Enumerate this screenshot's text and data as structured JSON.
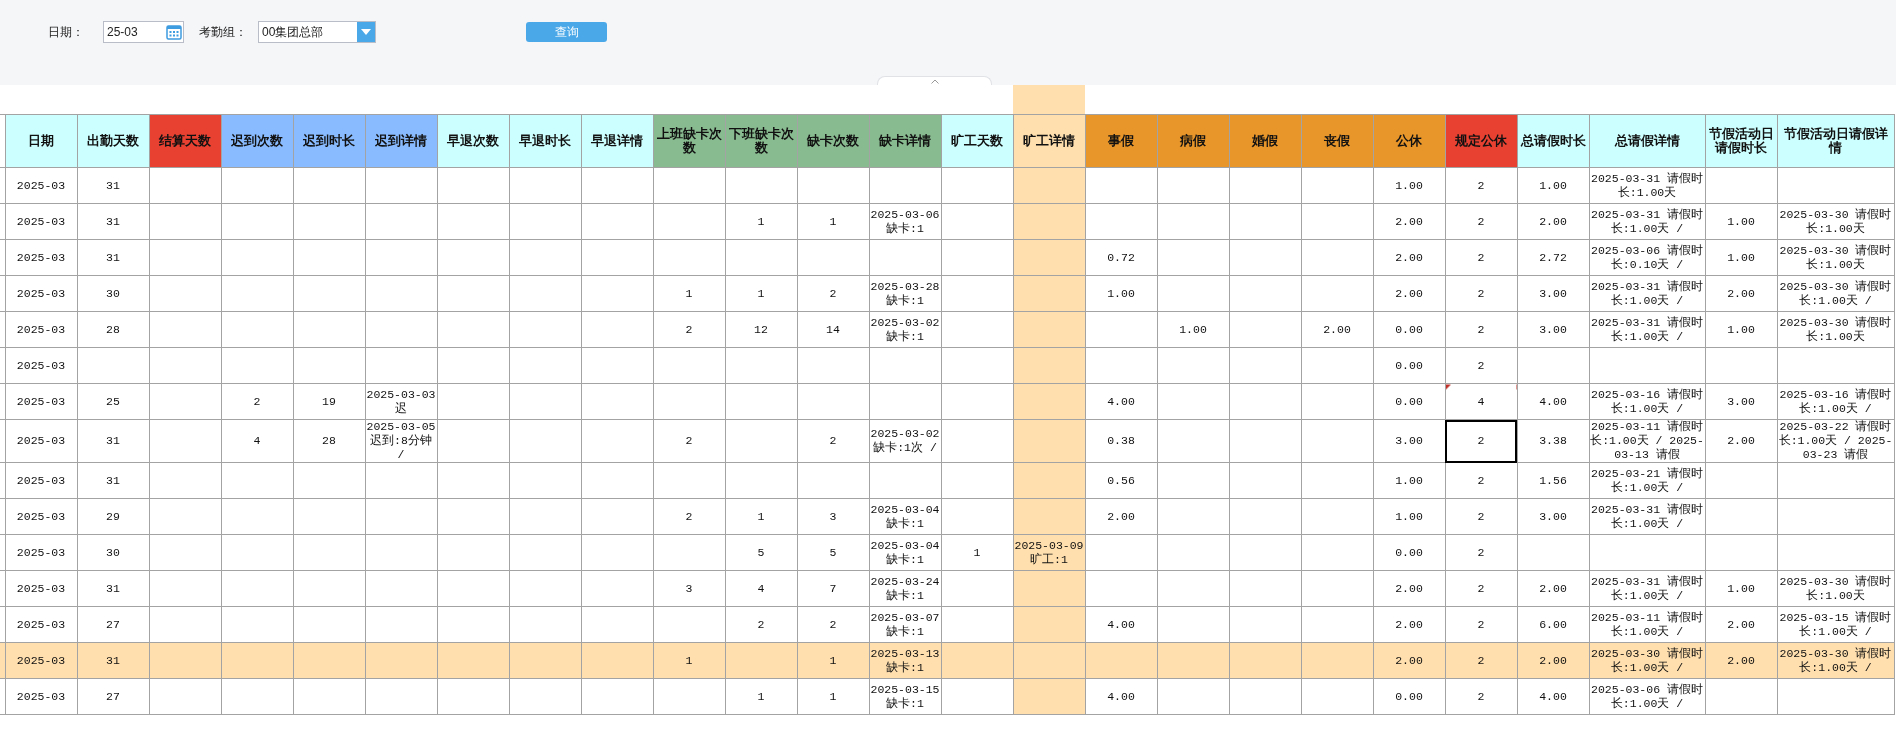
{
  "toolbar": {
    "date_label": "日期：",
    "date_field": {
      "value": "25-03"
    },
    "group_label": "考勤组：",
    "group_select": {
      "value": "00集团总部"
    },
    "query_button": "查询"
  },
  "table": {
    "columns": [
      {
        "label": "日期",
        "color": "#ccffff",
        "selected": false
      },
      {
        "label": "出勤天数",
        "color": "#ccffff",
        "selected": false
      },
      {
        "label": "结算天数",
        "color": "#e84132",
        "selected": false
      },
      {
        "label": "迟到次数",
        "color": "#88bbff",
        "selected": false
      },
      {
        "label": "迟到时长",
        "color": "#88bbff",
        "selected": false
      },
      {
        "label": "迟到详情",
        "color": "#88bbff",
        "selected": false
      },
      {
        "label": "早退次数",
        "color": "#ccffff",
        "selected": false
      },
      {
        "label": "早退时长",
        "color": "#ccffff",
        "selected": false
      },
      {
        "label": "早退详情",
        "color": "#ccffff",
        "selected": false
      },
      {
        "label": "上班缺卡次数",
        "color": "#88bb90",
        "selected": false
      },
      {
        "label": "下班缺卡次数",
        "color": "#88bb90",
        "selected": false
      },
      {
        "label": "缺卡次数",
        "color": "#88bb90",
        "selected": false
      },
      {
        "label": "缺卡详情",
        "color": "#88bb90",
        "selected": false
      },
      {
        "label": "旷工天数",
        "color": "#ccffff",
        "selected": false
      },
      {
        "label": "旷工详情",
        "selected": true
      },
      {
        "label": "事假",
        "color": "#e8952a",
        "selected": false
      },
      {
        "label": "病假",
        "color": "#e8952a",
        "selected": false
      },
      {
        "label": "婚假",
        "color": "#e8952a",
        "selected": false
      },
      {
        "label": "丧假",
        "color": "#e8952a",
        "selected": false
      },
      {
        "label": "公休",
        "color": "#e8952a",
        "selected": false
      },
      {
        "label": "规定公休",
        "color": "#e84132",
        "selected": false
      },
      {
        "label": "总请假时长",
        "color": "#ccffff",
        "selected": false
      },
      {
        "label": "总请假详情",
        "color": "#ccffff",
        "selected": false
      },
      {
        "label": "节假活动日请假时长",
        "color": "#ccffff",
        "selected": false
      },
      {
        "label": "节假活动日请假详情",
        "color": "#ccffff",
        "selected": false
      }
    ],
    "rows": [
      {
        "selected": false,
        "comment": false,
        "focused": false,
        "cells": [
          "2025-03",
          "31",
          "",
          "",
          "",
          "",
          "",
          "",
          "",
          "",
          "",
          "",
          "",
          "",
          "",
          "",
          "",
          "",
          "",
          "1.00",
          "2",
          "1.00",
          "2025-03-31 请假时长:1.00天",
          "",
          ""
        ]
      },
      {
        "selected": false,
        "comment": false,
        "focused": false,
        "cells": [
          "2025-03",
          "31",
          "",
          "",
          "",
          "",
          "",
          "",
          "",
          "",
          "1",
          "1",
          "2025-03-06 缺卡:1",
          "",
          "",
          "",
          "",
          "",
          "",
          "2.00",
          "2",
          "2.00",
          "2025-03-31 请假时长:1.00天 /",
          "1.00",
          "2025-03-30 请假时长:1.00天"
        ]
      },
      {
        "selected": false,
        "comment": false,
        "focused": false,
        "cells": [
          "2025-03",
          "31",
          "",
          "",
          "",
          "",
          "",
          "",
          "",
          "",
          "",
          "",
          "",
          "",
          "",
          "0.72",
          "",
          "",
          "",
          "2.00",
          "2",
          "2.72",
          "2025-03-06 请假时长:0.10天 /",
          "1.00",
          "2025-03-30 请假时长:1.00天"
        ]
      },
      {
        "selected": false,
        "comment": false,
        "focused": false,
        "cells": [
          "2025-03",
          "30",
          "",
          "",
          "",
          "",
          "",
          "",
          "",
          "1",
          "1",
          "2",
          "2025-03-28 缺卡:1",
          "",
          "",
          "1.00",
          "",
          "",
          "",
          "2.00",
          "2",
          "3.00",
          "2025-03-31 请假时长:1.00天 /",
          "2.00",
          "2025-03-30 请假时长:1.00天 /"
        ]
      },
      {
        "selected": false,
        "comment": false,
        "focused": false,
        "cells": [
          "2025-03",
          "28",
          "",
          "",
          "",
          "",
          "",
          "",
          "",
          "2",
          "12",
          "14",
          "2025-03-02 缺卡:1",
          "",
          "",
          "",
          "1.00",
          "",
          "2.00",
          "0.00",
          "2",
          "3.00",
          "2025-03-31 请假时长:1.00天 /",
          "1.00",
          "2025-03-30 请假时长:1.00天"
        ]
      },
      {
        "selected": false,
        "comment": false,
        "focused": false,
        "cells": [
          "2025-03",
          "",
          "",
          "",
          "",
          "",
          "",
          "",
          "",
          "",
          "",
          "",
          "",
          "",
          "",
          "",
          "",
          "",
          "",
          "0.00",
          "2",
          "",
          "",
          "",
          ""
        ]
      },
      {
        "selected": false,
        "comment": true,
        "focused": false,
        "cells": [
          "2025-03",
          "25",
          "",
          "2",
          "19",
          "2025-03-03 迟",
          "",
          "",
          "",
          "",
          "",
          "",
          "",
          "",
          "",
          "4.00",
          "",
          "",
          "",
          "0.00",
          "4",
          "4.00",
          "2025-03-16 请假时长:1.00天 /",
          "3.00",
          "2025-03-16 请假时长:1.00天 /"
        ]
      },
      {
        "selected": false,
        "comment": false,
        "focused": true,
        "cells": [
          "2025-03",
          "31",
          "",
          "4",
          "28",
          "2025-03-05 迟到:8分钟 /",
          "",
          "",
          "",
          "2",
          "",
          "2",
          "2025-03-02 缺卡:1次 /",
          "",
          "",
          "0.38",
          "",
          "",
          "",
          "3.00",
          "2",
          "3.38",
          "2025-03-11 请假时长:1.00天 / 2025-03-13 请假",
          "2.00",
          "2025-03-22 请假时长:1.00天 / 2025-03-23 请假"
        ]
      },
      {
        "selected": false,
        "comment": false,
        "focused": false,
        "cells": [
          "2025-03",
          "31",
          "",
          "",
          "",
          "",
          "",
          "",
          "",
          "",
          "",
          "",
          "",
          "",
          "",
          "0.56",
          "",
          "",
          "",
          "1.00",
          "2",
          "1.56",
          "2025-03-21 请假时长:1.00天 /",
          "",
          ""
        ]
      },
      {
        "selected": false,
        "comment": false,
        "focused": false,
        "cells": [
          "2025-03",
          "29",
          "",
          "",
          "",
          "",
          "",
          "",
          "",
          "2",
          "1",
          "3",
          "2025-03-04 缺卡:1",
          "",
          "",
          "2.00",
          "",
          "",
          "",
          "1.00",
          "2",
          "3.00",
          "2025-03-31 请假时长:1.00天 /",
          "",
          ""
        ]
      },
      {
        "selected": false,
        "comment": false,
        "focused": false,
        "cells": [
          "2025-03",
          "30",
          "",
          "",
          "",
          "",
          "",
          "",
          "",
          "",
          "5",
          "5",
          "2025-03-04 缺卡:1",
          "1",
          "2025-03-09 旷工:1",
          "",
          "",
          "",
          "",
          "0.00",
          "2",
          "",
          "",
          "",
          ""
        ]
      },
      {
        "selected": false,
        "comment": false,
        "focused": false,
        "cells": [
          "2025-03",
          "31",
          "",
          "",
          "",
          "",
          "",
          "",
          "",
          "3",
          "4",
          "7",
          "2025-03-24 缺卡:1",
          "",
          "",
          "",
          "",
          "",
          "",
          "2.00",
          "2",
          "2.00",
          "2025-03-31 请假时长:1.00天 /",
          "1.00",
          "2025-03-30 请假时长:1.00天"
        ]
      },
      {
        "selected": false,
        "comment": false,
        "focused": false,
        "cells": [
          "2025-03",
          "27",
          "",
          "",
          "",
          "",
          "",
          "",
          "",
          "",
          "2",
          "2",
          "2025-03-07 缺卡:1",
          "",
          "",
          "4.00",
          "",
          "",
          "",
          "2.00",
          "2",
          "6.00",
          "2025-03-11 请假时长:1.00天 /",
          "2.00",
          "2025-03-15 请假时长:1.00天 /"
        ]
      },
      {
        "selected": true,
        "comment": false,
        "focused": false,
        "cells": [
          "2025-03",
          "31",
          "",
          "",
          "",
          "",
          "",
          "",
          "",
          "1",
          "",
          "1",
          "2025-03-13 缺卡:1",
          "",
          "",
          "",
          "",
          "",
          "",
          "2.00",
          "2",
          "2.00",
          "2025-03-30 请假时长:1.00天 /",
          "2.00",
          "2025-03-30 请假时长:1.00天 /"
        ]
      },
      {
        "selected": false,
        "comment": false,
        "focused": false,
        "cells": [
          "2025-03",
          "27",
          "",
          "",
          "",
          "",
          "",
          "",
          "",
          "",
          "1",
          "1",
          "2025-03-15 缺卡:1",
          "",
          "",
          "4.00",
          "",
          "",
          "",
          "0.00",
          "2",
          "4.00",
          "2025-03-06 请假时长:1.00天 /",
          "",
          ""
        ]
      }
    ]
  }
}
